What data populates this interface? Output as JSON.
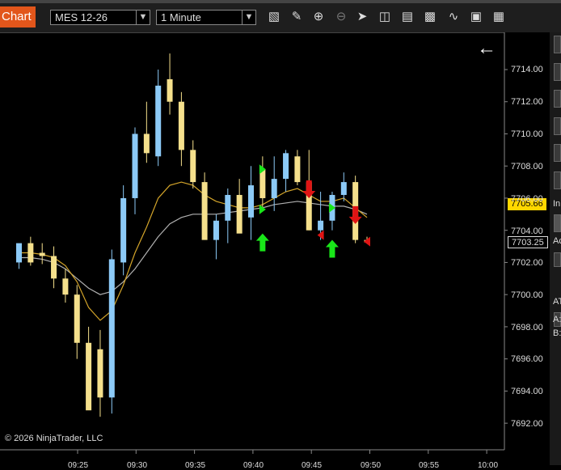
{
  "toolbar": {
    "tab_label": "Chart",
    "instrument": "MES 12-26",
    "interval": "1 Minute",
    "icons": [
      "bar-type-icon",
      "pencil-icon",
      "zoom-in-icon",
      "zoom-out-icon",
      "pointer-icon",
      "data-box-icon",
      "strategies-icon",
      "indicators-icon",
      "drawing-tools-icon",
      "properties-icon",
      "grid-icon"
    ]
  },
  "chart": {
    "copyright": "© 2026 NinjaTrader, LLC",
    "back_arrow": "←",
    "price_axis": [
      "7714.00",
      "7712.00",
      "7710.00",
      "7708.00",
      "7706.00",
      "7704.00",
      "7702.00",
      "7700.00",
      "7698.00",
      "7696.00",
      "7694.00",
      "7692.00"
    ],
    "time_axis": [
      "09:25",
      "09:30",
      "09:35",
      "09:40",
      "09:45",
      "09:50",
      "09:55",
      "10:00"
    ],
    "last_price": "7705.66",
    "current_price": "7703.25"
  },
  "right_panel": {
    "labels": [
      "In",
      "Ac",
      "AT",
      "A:",
      "B:"
    ]
  },
  "colors": {
    "up": "#8ccaf7",
    "down": "#f5e08c",
    "ma_fast": "#d4a52a",
    "ma_slow": "#b0b0b0",
    "accent": "#e2561b",
    "price_tag": "#ffd700"
  },
  "chart_data": {
    "type": "candlestick",
    "ylim": [
      7691,
      7716
    ],
    "bars": [
      {
        "o": 7702.0,
        "h": 7703.0,
        "l": 7701.6,
        "c": 7703.2
      },
      {
        "o": 7703.2,
        "h": 7703.6,
        "l": 7701.8,
        "c": 7702.0
      },
      {
        "o": 7702.6,
        "h": 7703.2,
        "l": 7701.9,
        "c": 7702.4
      },
      {
        "o": 7702.4,
        "h": 7703.0,
        "l": 7700.4,
        "c": 7701.0
      },
      {
        "o": 7701.0,
        "h": 7701.6,
        "l": 7699.5,
        "c": 7700.0
      },
      {
        "o": 7700.0,
        "h": 7700.6,
        "l": 7696.0,
        "c": 7697.0
      },
      {
        "o": 7697.0,
        "h": 7698.0,
        "l": 7694.0,
        "c": 7692.8
      },
      {
        "o": 7696.6,
        "h": 7697.8,
        "l": 7692.4,
        "c": 7693.6
      },
      {
        "o": 7693.6,
        "h": 7702.8,
        "l": 7692.6,
        "c": 7702.2
      },
      {
        "o": 7702.0,
        "h": 7706.8,
        "l": 7701.2,
        "c": 7706.0
      },
      {
        "o": 7706.0,
        "h": 7710.4,
        "l": 7705.0,
        "c": 7710.0
      },
      {
        "o": 7710.0,
        "h": 7712.0,
        "l": 7708.2,
        "c": 7708.8
      },
      {
        "o": 7708.6,
        "h": 7714.0,
        "l": 7708.0,
        "c": 7713.0
      },
      {
        "o": 7713.4,
        "h": 7715.0,
        "l": 7711.2,
        "c": 7712.0
      },
      {
        "o": 7712.0,
        "h": 7712.6,
        "l": 7708.0,
        "c": 7709.0
      },
      {
        "o": 7709.0,
        "h": 7709.6,
        "l": 7706.6,
        "c": 7707.0
      },
      {
        "o": 7707.0,
        "h": 7707.6,
        "l": 7704.0,
        "c": 7703.4
      },
      {
        "o": 7703.4,
        "h": 7705.0,
        "l": 7702.2,
        "c": 7704.6
      },
      {
        "o": 7704.6,
        "h": 7706.6,
        "l": 7703.2,
        "c": 7706.2
      },
      {
        "o": 7706.2,
        "h": 7707.2,
        "l": 7704.0,
        "c": 7703.8
      },
      {
        "o": 7704.8,
        "h": 7708.0,
        "l": 7703.4,
        "c": 7706.8
      },
      {
        "o": 7707.8,
        "h": 7708.6,
        "l": 7705.4,
        "c": 7706.0
      },
      {
        "o": 7706.0,
        "h": 7708.6,
        "l": 7705.2,
        "c": 7707.2
      },
      {
        "o": 7707.2,
        "h": 7709.0,
        "l": 7706.4,
        "c": 7708.8
      },
      {
        "o": 7708.6,
        "h": 7709.0,
        "l": 7706.8,
        "c": 7707.0
      },
      {
        "o": 7707.0,
        "h": 7709.0,
        "l": 7704.0,
        "c": 7704.0
      },
      {
        "o": 7704.0,
        "h": 7706.4,
        "l": 7703.4,
        "c": 7704.6
      },
      {
        "o": 7704.6,
        "h": 7706.4,
        "l": 7704.0,
        "c": 7706.2
      },
      {
        "o": 7706.2,
        "h": 7707.6,
        "l": 7705.8,
        "c": 7707.0
      },
      {
        "o": 7707.0,
        "h": 7707.4,
        "l": 7703.2,
        "c": 7703.4
      },
      {
        "o": 7703.4,
        "h": 7703.6,
        "l": 7703.2,
        "c": 7703.25
      }
    ],
    "ma_fast": [
      7702.6,
      7702.6,
      7702.5,
      7702.3,
      7701.8,
      7700.8,
      7699.2,
      7698.4,
      7699.0,
      7700.6,
      7702.6,
      7704.2,
      7706.0,
      7706.8,
      7707.0,
      7706.8,
      7706.2,
      7705.8,
      7705.6,
      7705.4,
      7705.4,
      7705.6,
      7706.0,
      7706.4,
      7706.6,
      7706.2,
      7705.8,
      7705.8,
      7706.0,
      7705.4,
      7704.8
    ],
    "ma_slow": [
      7702.3,
      7702.3,
      7702.2,
      7702.0,
      7701.6,
      7701.0,
      7700.4,
      7700.0,
      7700.2,
      7700.8,
      7701.6,
      7702.6,
      7703.6,
      7704.4,
      7704.8,
      7705.0,
      7705.0,
      7705.0,
      7705.1,
      7705.2,
      7705.3,
      7705.4,
      7705.6,
      7705.7,
      7705.8,
      7705.7,
      7705.6,
      7705.5,
      7705.5,
      7705.3,
      7705.0
    ],
    "signals": [
      {
        "bar": 21,
        "kind": "arrow-up",
        "price": 7703.2
      },
      {
        "bar": 25,
        "kind": "arrow-down",
        "price": 7706.6
      },
      {
        "bar": 27,
        "kind": "arrow-up",
        "price": 7702.8
      },
      {
        "bar": 29,
        "kind": "arrow-down",
        "price": 7705.0
      },
      {
        "bar": 21,
        "kind": "tri-right",
        "price": 7707.8
      },
      {
        "bar": 21,
        "kind": "tri-right",
        "price": 7705.3
      },
      {
        "bar": 26,
        "kind": "tri-left",
        "price": 7703.7
      },
      {
        "bar": 27,
        "kind": "tri-right",
        "price": 7705.4
      },
      {
        "bar": 30,
        "kind": "tri-left",
        "price": 7703.3
      }
    ]
  }
}
